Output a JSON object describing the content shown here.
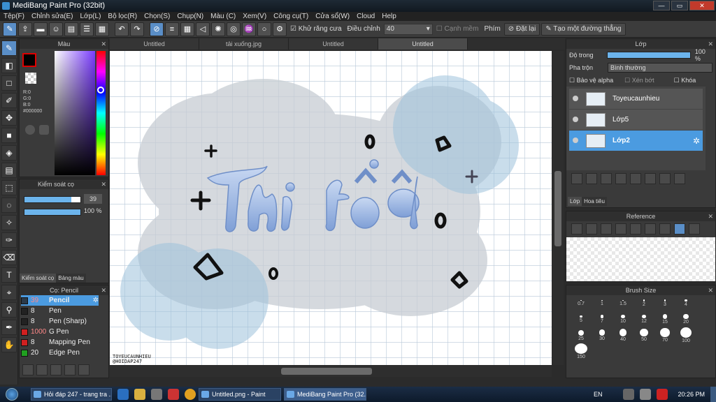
{
  "window": {
    "title": "MediBang Paint Pro (32bit)"
  },
  "menu": [
    "Tệp(F)",
    "Chỉnh sửa(E)",
    "Lớp(L)",
    "Bộ lọc(R)",
    "Chọn(S)",
    "Chụp(N)",
    "Màu (C)",
    "Xem(V)",
    "Công cụ(T)",
    "Cửa sổ(W)",
    "Cloud",
    "Help"
  ],
  "toolbar": {
    "antialias_label": "Khử răng cưa",
    "adjust_label": "Điều chỉnh",
    "adjust_value": "40",
    "edge_label": "Cạnh mềm",
    "key_label": "Phím",
    "reset_label": "Đặt lại",
    "straight_label": "Tạo một đường thẳng"
  },
  "color_panel": {
    "title": "Màu",
    "r": "R:0",
    "g": "G:0",
    "b": "B:0",
    "hex": "#000000"
  },
  "control_panel": {
    "title": "Kiểm soát cọ",
    "size_value": "39",
    "opacity_value": "100 %",
    "size_fill": 0.84,
    "opacity_fill": 1.0,
    "tab1": "Kiểm soát cọ",
    "tab2": "Bảng màu"
  },
  "brush_panel": {
    "title": "Cọ: Pencil",
    "items": [
      {
        "size": "39",
        "name": "Pencil",
        "color": "#2a3a4a",
        "selected": true
      },
      {
        "size": "8",
        "name": "Pen",
        "color": "#222222",
        "selected": false
      },
      {
        "size": "8",
        "name": "Pen (Sharp)",
        "color": "#222222",
        "selected": false
      },
      {
        "size": "1000",
        "name": "G Pen",
        "color": "#d02020",
        "selected": false
      },
      {
        "size": "8",
        "name": "Mapping Pen",
        "color": "#d02020",
        "selected": false
      },
      {
        "size": "20",
        "name": "Edge Pen",
        "color": "#20a020",
        "selected": false
      }
    ]
  },
  "tabs": [
    "Untitled",
    "tải xuống.jpg",
    "Untitled",
    "Untitled"
  ],
  "canvas": {
    "text": "Thi tốt",
    "watermark1": "TOYEUCAUNHIEU",
    "watermark2": "@HOIDAP247"
  },
  "layer_panel": {
    "title": "Lớp",
    "opacity_label": "Độ trong",
    "opacity_value": "100 %",
    "opacity_fill": 1.0,
    "blend_label": "Pha trộn",
    "blend_value": "Bình thường",
    "alpha_label": "Bảo vệ alpha",
    "clip_label": "Xén bớt",
    "lock_label": "Khóa",
    "layers": [
      "Toyeucaunhieu",
      "Lớp5",
      "Lớp2"
    ],
    "tab1": "Lớp",
    "tab2": "Hoa tiêu"
  },
  "reference_panel": {
    "title": "Reference"
  },
  "brushsize_panel": {
    "title": "Brush Size",
    "sizes": [
      "0.7",
      "1",
      "1.5",
      "2",
      "3",
      "4",
      "5",
      "7",
      "10",
      "12",
      "15",
      "20",
      "25",
      "30",
      "40",
      "50",
      "70",
      "100",
      "150"
    ]
  },
  "taskbar": {
    "tasks": [
      "Hỏi đáp 247 - trang tra ...",
      "Untitled.png - Paint",
      "MediBang Paint Pro (32..."
    ],
    "lang": "EN",
    "time": "20:26 PM"
  }
}
